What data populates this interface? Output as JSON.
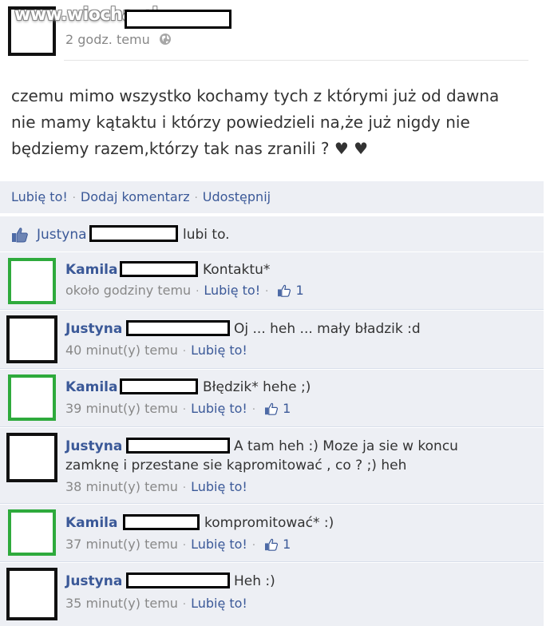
{
  "watermark": "www.wiocha.pl",
  "post": {
    "time": "2 godz. temu",
    "text": "czemu mimo wszystko kochamy tych z którymi już od dawna nie mamy kątaktu i którzy powiedzieli na,że już nigdy nie będziemy razem,którzy tak nas zranili ? ♥ ♥",
    "icons": {
      "audience": "globe-icon"
    }
  },
  "actions": {
    "like": "Lubię to!",
    "comment": "Dodaj komentarz",
    "share": "Udostępnij"
  },
  "likes": {
    "name": "Justyna",
    "suffix": "lubi to."
  },
  "comments": [
    {
      "name": "Kamila",
      "text": "Kontaktu*",
      "time": "około godziny temu",
      "like": "Lubię to!",
      "likes": "1",
      "avatar": "green"
    },
    {
      "name": "Justyna",
      "text": "Oj ... heh ... mały bładzik :d",
      "time": "40 minut(y) temu",
      "like": "Lubię to!",
      "likes": "",
      "avatar": "black"
    },
    {
      "name": "Kamila",
      "text": "Błędzik* hehe ;)",
      "time": "39 minut(y) temu",
      "like": "Lubię to!",
      "likes": "1",
      "avatar": "green"
    },
    {
      "name": "Justyna",
      "text_line1": "A tam heh :) Moze ja sie w koncu",
      "text_line2": "zamknę i przestane sie kąpromitować , co ? ;) heh",
      "time": "38 minut(y) temu",
      "like": "Lubię to!",
      "likes": "",
      "avatar": "black"
    },
    {
      "name": "Kamila",
      "text": "kompromitować* :)",
      "time": "37 minut(y) temu",
      "like": "Lubię to!",
      "likes": "1",
      "avatar": "green"
    },
    {
      "name": "Justyna",
      "text": "Heh :)",
      "time": "35 minut(y) temu",
      "like": "Lubię to!",
      "likes": "",
      "avatar": "black"
    }
  ],
  "colors": {
    "link": "#3b5998",
    "panel": "#edeff4",
    "green_avatar": "#2eaa3c"
  }
}
